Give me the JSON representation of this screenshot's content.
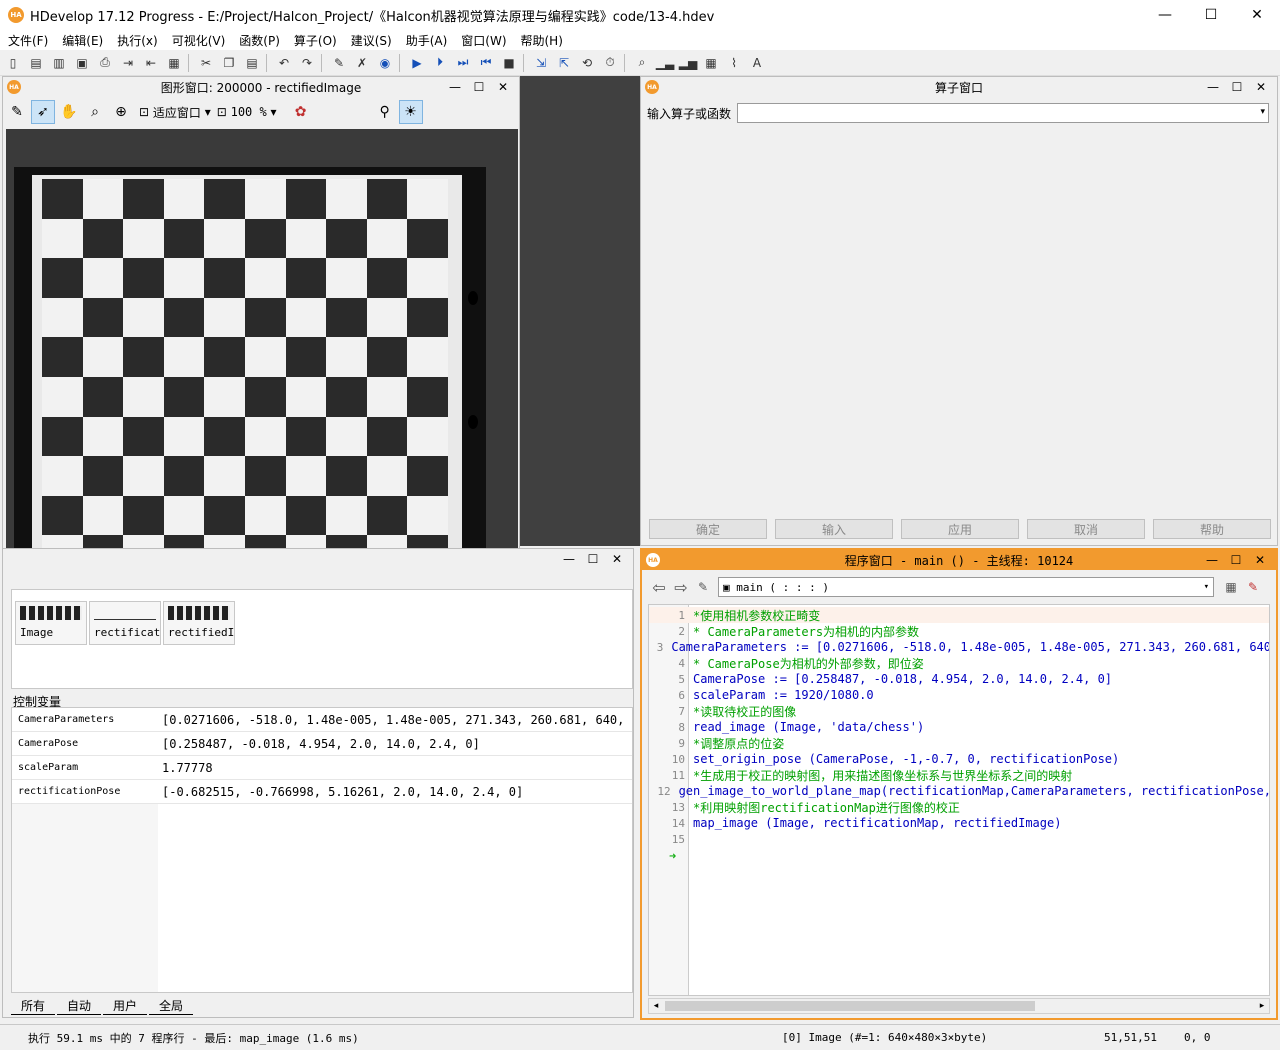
{
  "window": {
    "title": "HDevelop 17.12 Progress - E:/Project/Halcon_Project/《Halcon机器视觉算法原理与编程实践》code/13-4.hdev",
    "min": "—",
    "max": "☐",
    "close": "✕"
  },
  "menu": [
    "文件(F)",
    "编辑(E)",
    "执行(x)",
    "可视化(V)",
    "函数(P)",
    "算子(O)",
    "建议(S)",
    "助手(A)",
    "窗口(W)",
    "帮助(H)"
  ],
  "graphics": {
    "title": "图形窗口: 200000 - rectifiedImage",
    "fit_label": "适应窗口",
    "zoom": "100 %"
  },
  "variables": {
    "iconic": [
      "Image",
      "rectificat",
      "rectifiedI"
    ],
    "control_label": "控制变量",
    "control": [
      {
        "name": "CameraParameters",
        "value": "[0.0271606, -518.0, 1.48e-005, 1.48e-005, 271.343, 260.681, 640, …"
      },
      {
        "name": "CameraPose",
        "value": "[0.258487, -0.018, 4.954, 2.0, 14.0, 2.4, 0]"
      },
      {
        "name": "scaleParam",
        "value": "1.77778"
      },
      {
        "name": "rectificationPose",
        "value": "[-0.682515, -0.766998, 5.16261, 2.0, 14.0, 2.4, 0]"
      }
    ],
    "tabs": [
      "所有",
      "自动",
      "用户",
      "全局"
    ]
  },
  "operator": {
    "title": "算子窗口",
    "input_label": "输入算子或函数",
    "buttons": [
      "确定",
      "输入",
      "应用",
      "取消",
      "帮助"
    ]
  },
  "program": {
    "title": "程序窗口 - main () - 主线程: 10124",
    "procedure": "main ( : : : )",
    "lines": [
      {
        "n": "1",
        "text": "*使用相机参数校正畸变",
        "type": "comment"
      },
      {
        "n": "2",
        "text": "* CameraParameters为相机的内部参数",
        "type": "comment"
      },
      {
        "n": "3",
        "text": "CameraParameters := [0.0271606, -518.0, 1.48e-005, 1.48e-005, 271.343, 260.681, 640",
        "type": "assign"
      },
      {
        "n": "4",
        "text": "* CameraPose为相机的外部参数，即位姿",
        "type": "comment"
      },
      {
        "n": "5",
        "text": "CameraPose := [0.258487, -0.018, 4.954, 2.0, 14.0, 2.4, 0]",
        "type": "assign"
      },
      {
        "n": "6",
        "text": "scaleParam := 1920/1080.0",
        "type": "assign"
      },
      {
        "n": "7",
        "text": "*读取待校正的图像",
        "type": "comment"
      },
      {
        "n": "8",
        "text": "read_image (Image, 'data/chess')",
        "type": "call"
      },
      {
        "n": "9",
        "text": "*调整原点的位姿",
        "type": "comment"
      },
      {
        "n": "10",
        "text": "set_origin_pose (CameraPose, -1,-0.7, 0, rectificationPose)",
        "type": "call"
      },
      {
        "n": "11",
        "text": "*生成用于校正的映射图，用来描述图像坐标系与世界坐标系之间的映射",
        "type": "comment"
      },
      {
        "n": "12",
        "text": "gen_image_to_world_plane_map(rectificationMap,CameraParameters, rectificationPose,",
        "type": "call"
      },
      {
        "n": "13",
        "text": "*利用映射图rectificationMap进行图像的校正",
        "type": "comment"
      },
      {
        "n": "14",
        "text": "map_image (Image, rectificationMap, rectifiedImage)",
        "type": "call"
      },
      {
        "n": "15",
        "text": "",
        "type": "blank"
      }
    ]
  },
  "status": {
    "message": "执行 59.1 ms 中的 7 程序行 - 最后: map_image (1.6 ms)",
    "image": "[0] Image (#=1: 640×480×3×byte)",
    "gray": "51,51,51",
    "coord": "0, 0"
  },
  "colors": {
    "accent": "#f29a2e",
    "comment": "#00a000",
    "keyword": "#0000c0",
    "pc_arrow": "#19b019"
  }
}
